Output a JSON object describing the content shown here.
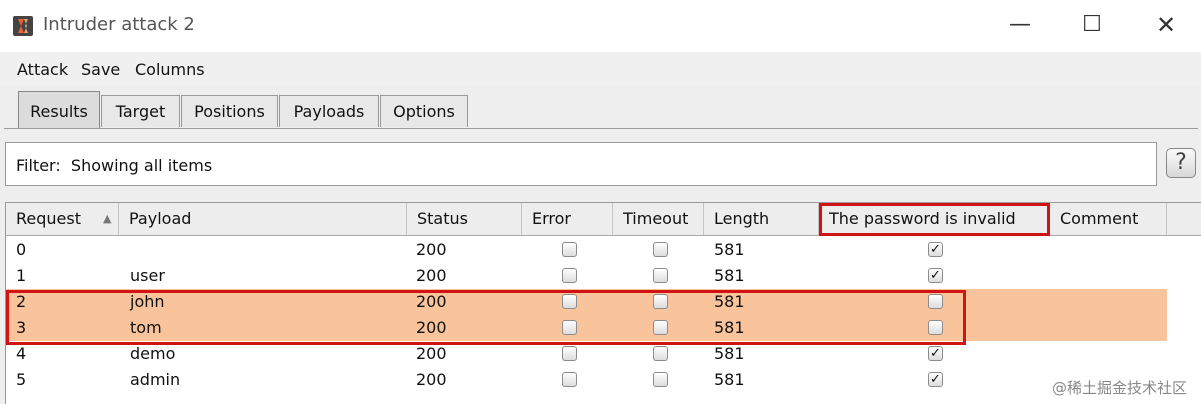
{
  "window": {
    "title": "Intruder attack 2",
    "controls": {
      "minimize": "—",
      "maximize": "☐",
      "close": "✕"
    }
  },
  "menu": [
    "Attack",
    "Save",
    "Columns"
  ],
  "tabs": [
    {
      "label": "Results",
      "active": true
    },
    {
      "label": "Target",
      "active": false
    },
    {
      "label": "Positions",
      "active": false
    },
    {
      "label": "Payloads",
      "active": false
    },
    {
      "label": "Options",
      "active": false
    }
  ],
  "filter": {
    "label": "Filter:",
    "text": "Showing all items"
  },
  "help": {
    "label": "?"
  },
  "table": {
    "columns": [
      "Request",
      "Payload",
      "Status",
      "Error",
      "Timeout",
      "Length",
      "The password is invalid",
      "Comment"
    ],
    "rows": [
      {
        "request": "0",
        "payload": "",
        "status": "200",
        "error": false,
        "timeout": false,
        "length": "581",
        "invalid": true,
        "comment": "",
        "highlighted": false
      },
      {
        "request": "1",
        "payload": "user",
        "status": "200",
        "error": false,
        "timeout": false,
        "length": "581",
        "invalid": true,
        "comment": "",
        "highlighted": false
      },
      {
        "request": "2",
        "payload": "john",
        "status": "200",
        "error": false,
        "timeout": false,
        "length": "581",
        "invalid": false,
        "comment": "",
        "highlighted": true
      },
      {
        "request": "3",
        "payload": "tom",
        "status": "200",
        "error": false,
        "timeout": false,
        "length": "581",
        "invalid": false,
        "comment": "",
        "highlighted": true
      },
      {
        "request": "4",
        "payload": "demo",
        "status": "200",
        "error": false,
        "timeout": false,
        "length": "581",
        "invalid": true,
        "comment": "",
        "highlighted": false
      },
      {
        "request": "5",
        "payload": "admin",
        "status": "200",
        "error": false,
        "timeout": false,
        "length": "581",
        "invalid": true,
        "comment": "",
        "highlighted": false
      }
    ]
  },
  "colors": {
    "highlight_row": "#f9c49c",
    "annotation_red": "#d01414"
  },
  "icons": {
    "app": "burp-suite-icon",
    "sort": "sort-ascending-icon",
    "check": "check-icon"
  },
  "watermark": "@稀土掘金技术社区"
}
